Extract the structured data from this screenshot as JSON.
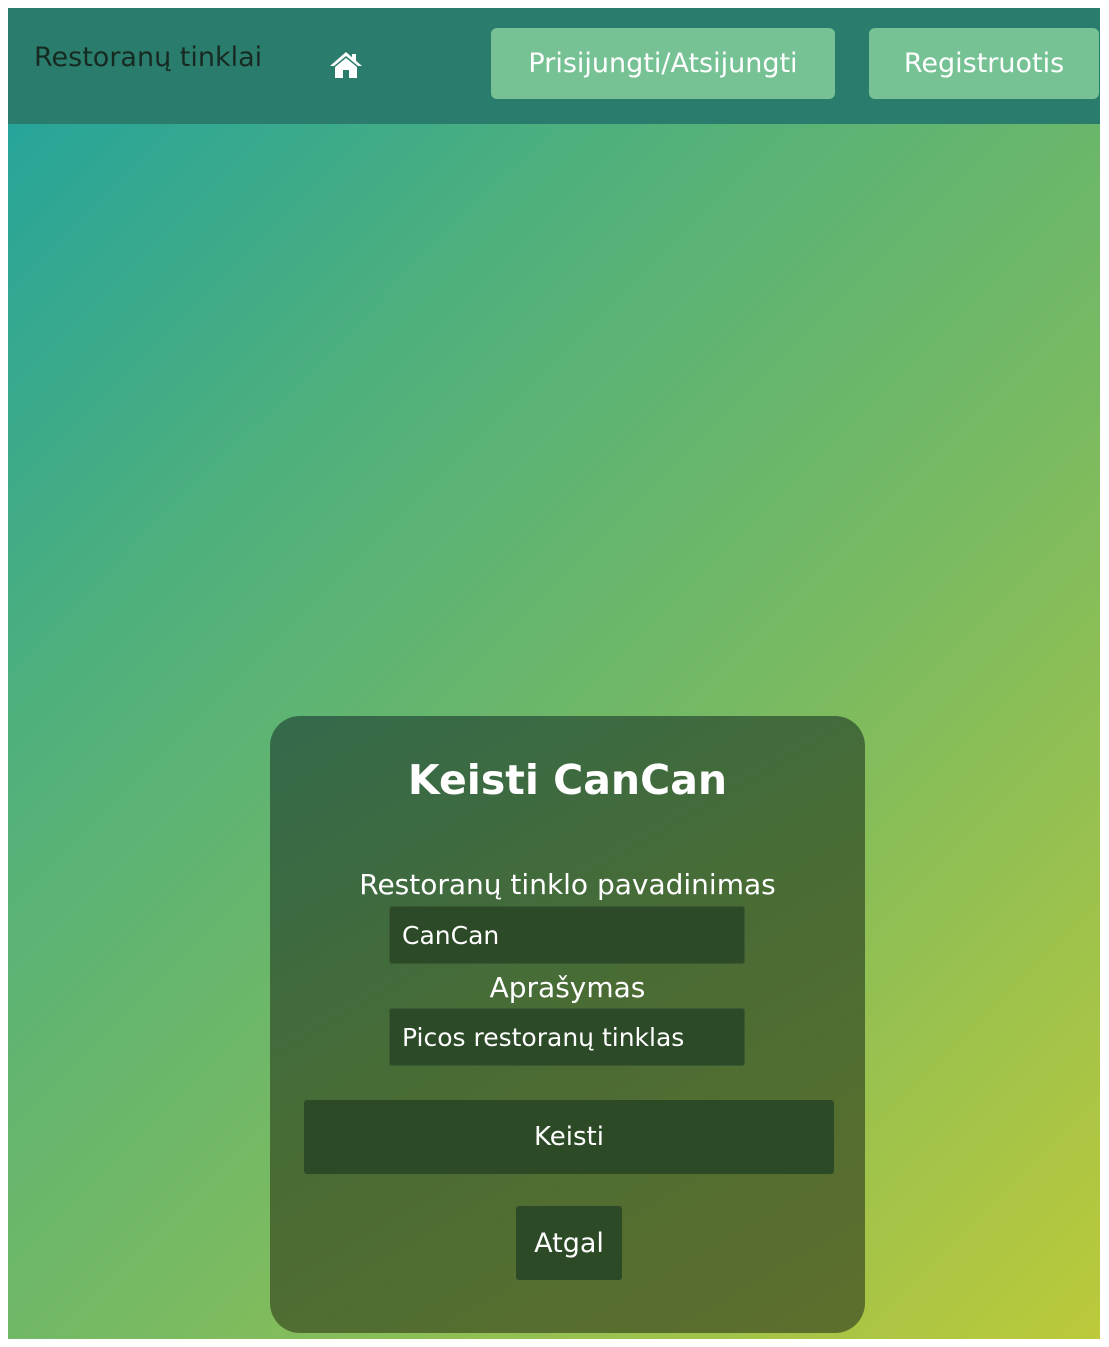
{
  "navbar": {
    "brand": "Restoranų tinklai",
    "home_icon": "home-icon",
    "login_label": "Prisijungti/Atsijungti",
    "register_label": "Registruotis"
  },
  "form": {
    "title": "Keisti CanCan",
    "name_label": "Restoranų tinklo pavadinimas",
    "name_value": "CanCan",
    "description_label": "Aprašymas",
    "description_value": "Picos restoranų tinklas",
    "submit_label": "Keisti",
    "back_label": "Atgal"
  },
  "colors": {
    "navbar": "#2a7d6c",
    "nav_button": "#77c295",
    "card": "#4a6c34",
    "input": "#2c4a27",
    "button": "#2d4a27"
  }
}
